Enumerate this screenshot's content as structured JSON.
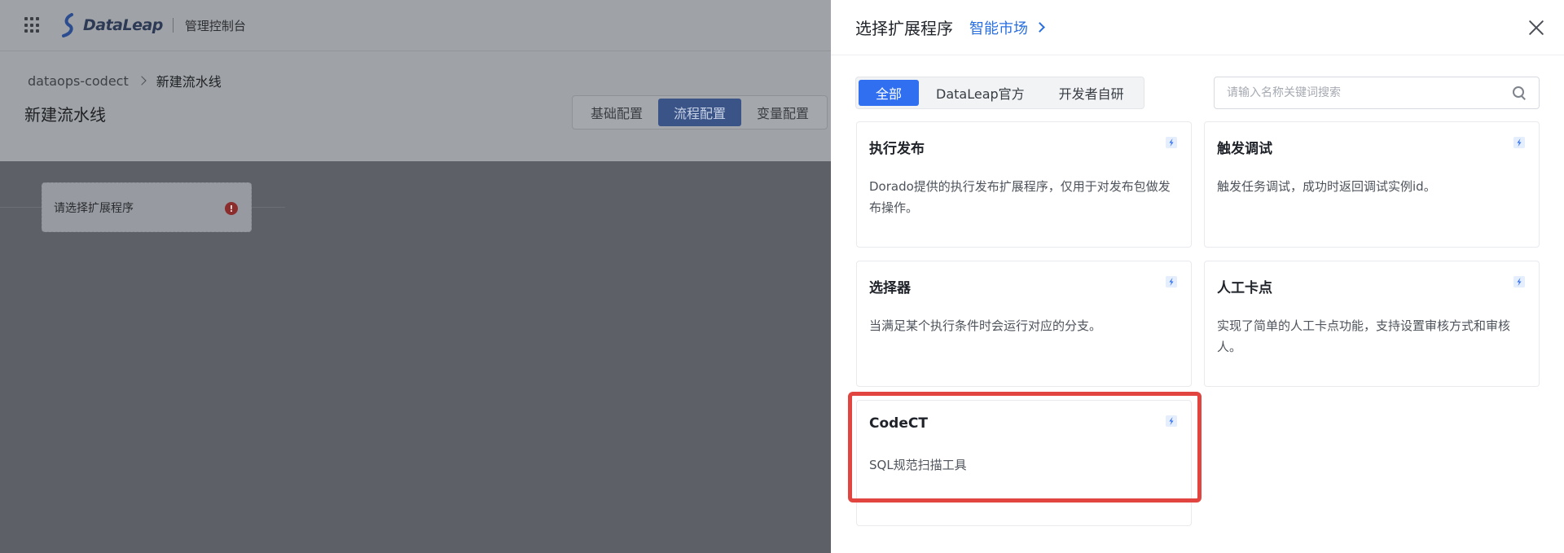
{
  "app": {
    "logo_text": "DataLeap",
    "console_label": "管理控制台"
  },
  "breadcrumb": {
    "parent": "dataops-codect",
    "current": "新建流水线"
  },
  "page_title": "新建流水线",
  "config_tabs": [
    {
      "label": "基础配置",
      "active": false
    },
    {
      "label": "流程配置",
      "active": true
    },
    {
      "label": "变量配置",
      "active": false
    }
  ],
  "canvas": {
    "node_label": "请选择扩展程序",
    "node_error_glyph": "!"
  },
  "drawer": {
    "title": "选择扩展程序",
    "market_link": "智能市场",
    "filter_tabs": [
      {
        "label": "全部",
        "active": true
      },
      {
        "label": "DataLeap官方",
        "active": false
      },
      {
        "label": "开发者自研",
        "active": false
      }
    ],
    "search_placeholder": "请输入名称关键词搜索",
    "cards": [
      {
        "name": "执行发布",
        "desc": "Dorado提供的执行发布扩展程序，仅用于对发布包做发布操作。"
      },
      {
        "name": "触发调试",
        "desc": "触发任务调试，成功时返回调试实例id。"
      },
      {
        "name": "选择器",
        "desc": "当满足某个执行条件时会运行对应的分支。"
      },
      {
        "name": "人工卡点",
        "desc": "实现了简单的人工卡点功能，支持设置审核方式和审核人。"
      },
      {
        "name": "CodeCT",
        "desc": "SQL规范扫描工具"
      }
    ]
  },
  "colors": {
    "accent": "#2f6ff0",
    "link": "#2a6fe0",
    "highlight": "#e2453f"
  }
}
